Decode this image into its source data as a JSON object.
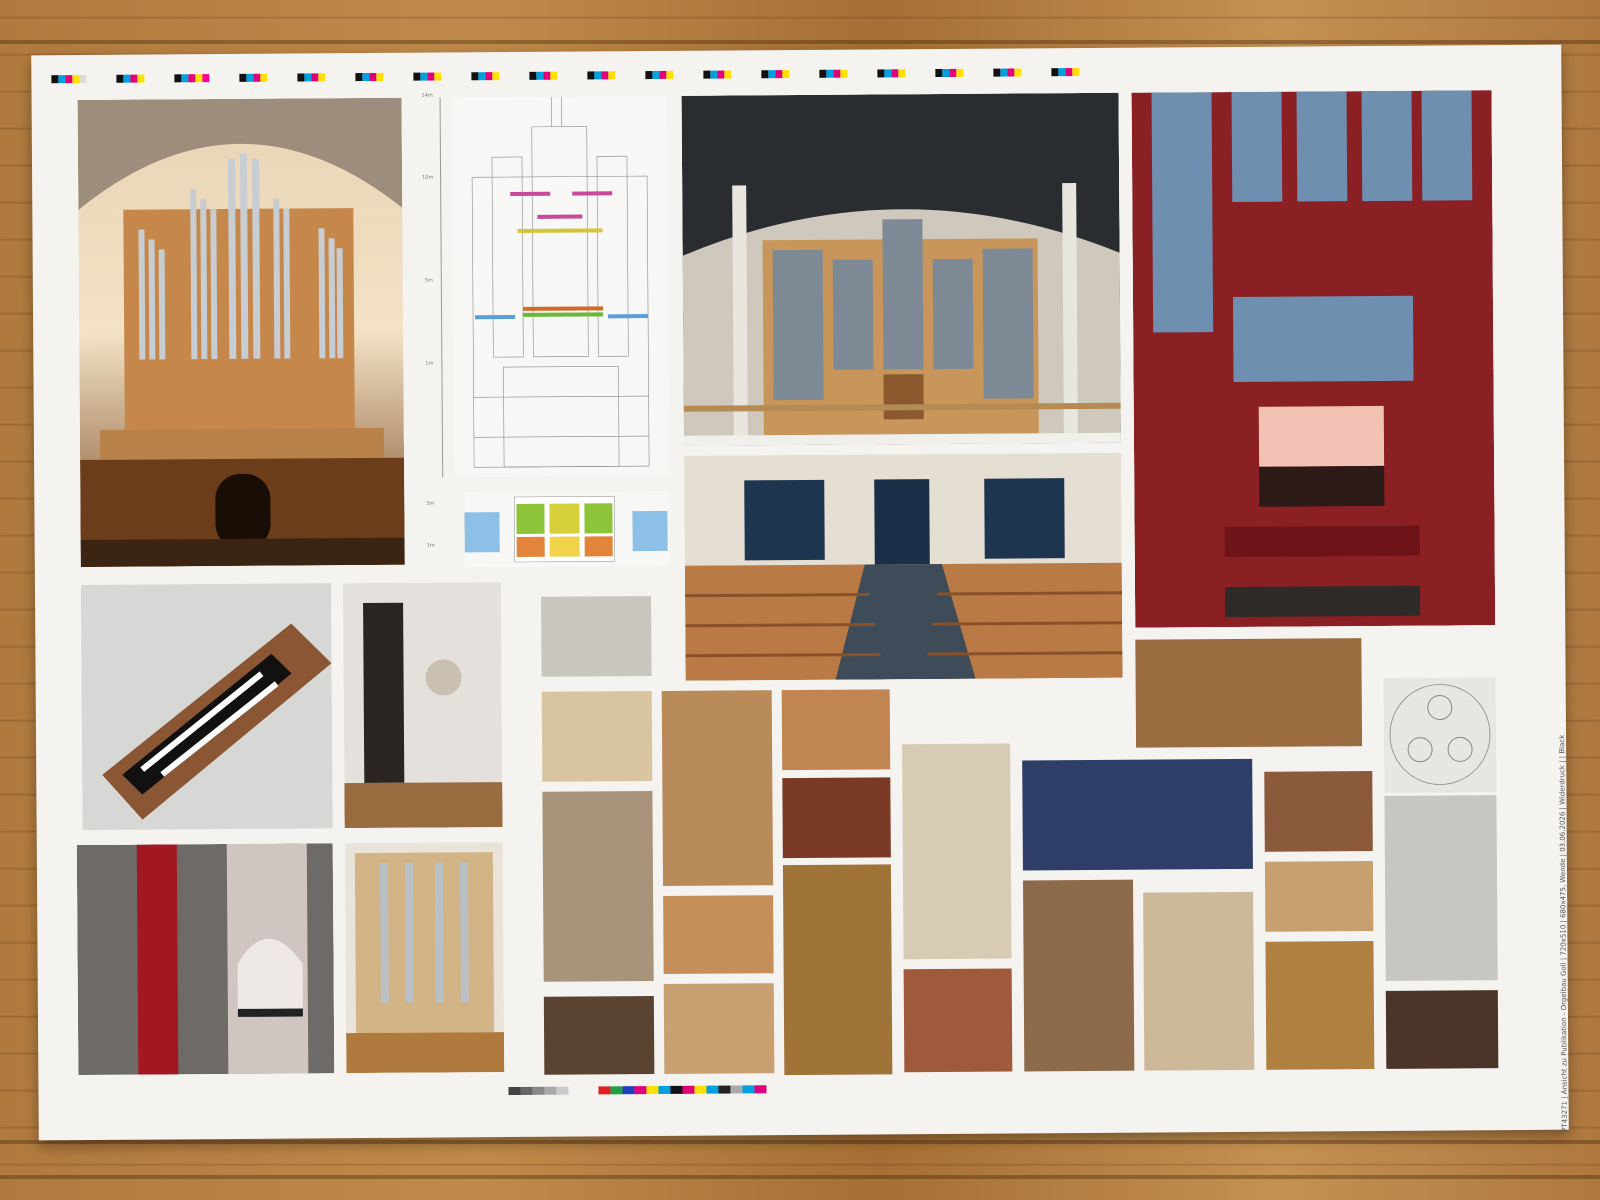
{
  "print_slug": "PT43271 | Ansicht zu Publikation - Orgelbau Goll | 720x510 | 680x475, Wende | 03.06.2026 | Widerdruck | | Black",
  "scale_labels": [
    "14m",
    "10m",
    "5m",
    "1m",
    "5m",
    "1m"
  ],
  "colors": {
    "sheet": "#f4f3f0",
    "wood_floor": "#b07a3e",
    "organ_red": "#8a1f24",
    "pipe_silver": "#b9c0c6",
    "church_wood": "#c8955a"
  },
  "photos": [
    {
      "name": "organ-gothic-church-photo"
    },
    {
      "name": "organ-elevation-drawing"
    },
    {
      "name": "organ-ground-plan-drawing"
    },
    {
      "name": "modern-church-organ-photo"
    },
    {
      "name": "church-nave-pews-photo"
    },
    {
      "name": "red-organ-console-photo"
    }
  ]
}
